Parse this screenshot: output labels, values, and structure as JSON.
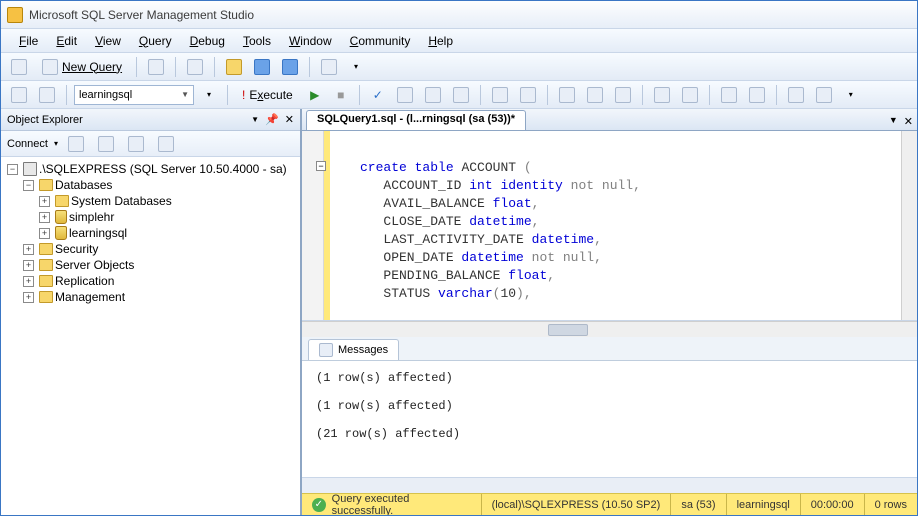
{
  "window": {
    "title": "Microsoft SQL Server Management Studio"
  },
  "menus": {
    "file": "File",
    "edit": "Edit",
    "view": "View",
    "query": "Query",
    "debug": "Debug",
    "tools": "Tools",
    "window": "Window",
    "community": "Community",
    "help": "Help"
  },
  "toolbar": {
    "new_query": "New Query",
    "database_selected": "learningsql",
    "execute": "Execute"
  },
  "object_explorer": {
    "title": "Object Explorer",
    "connect_label": "Connect",
    "server": ".\\SQLEXPRESS (SQL Server 10.50.4000 - sa)",
    "databases": "Databases",
    "system_databases": "System Databases",
    "db1": "simplehr",
    "db2": "learningsql",
    "security": "Security",
    "server_objects": "Server Objects",
    "replication": "Replication",
    "management": "Management"
  },
  "editor": {
    "tab_title": "SQLQuery1.sql - (l...rningsql (sa (53))*"
  },
  "sql": {
    "line1_a": "create",
    "line1_b": "table",
    "line1_c": " ACCOUNT ",
    "line2_a": "   ACCOUNT_ID ",
    "line2_b": "int",
    "line2_c": "identity",
    "line2_d": "not",
    "line2_e": "null",
    "line3_a": "   AVAIL_BALANCE ",
    "line3_b": "float",
    "line4_a": "   CLOSE_DATE ",
    "line4_b": "datetime",
    "line5_a": "   LAST_ACTIVITY_DATE ",
    "line5_b": "datetime",
    "line6_a": "   OPEN_DATE ",
    "line6_b": "datetime",
    "line6_c": "not",
    "line6_d": "null",
    "line7_a": "   PENDING_BALANCE ",
    "line7_b": "float",
    "line8_a": "   STATUS ",
    "line8_b": "varchar",
    "line8_c": "10"
  },
  "messages": {
    "tab": "Messages",
    "m1": "(1 row(s) affected)",
    "m2": "(1 row(s) affected)",
    "m3": "(21 row(s) affected)"
  },
  "status": {
    "text": "Query executed successfully.",
    "server": "(local)\\SQLEXPRESS (10.50 SP2)",
    "user": "sa (53)",
    "db": "learningsql",
    "time": "00:00:00",
    "rows": "0 rows"
  }
}
